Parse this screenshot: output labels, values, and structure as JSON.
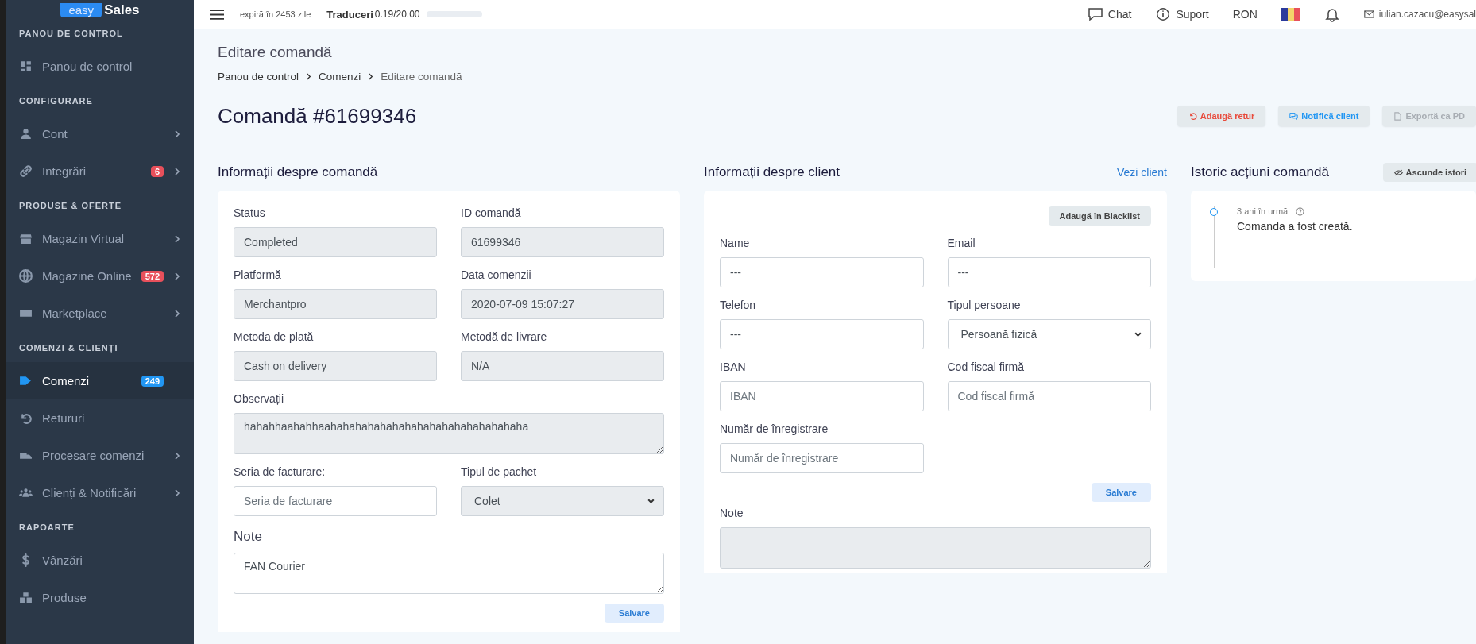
{
  "logo": {
    "part_1": "easy",
    "part_2": "Sales"
  },
  "sidebar": {
    "sections": [
      {
        "title": "PANOU DE CONTROL",
        "items": [
          {
            "label": "Panou de control",
            "expandable": false,
            "selected": false
          }
        ]
      },
      {
        "title": "CONFIGURARE",
        "items": [
          {
            "label": "Cont",
            "expandable": true,
            "selected": false
          },
          {
            "label": "Integrări",
            "expandable": true,
            "selected": false,
            "badge": "6",
            "color": "#e8505b"
          }
        ]
      },
      {
        "title": "PRODUSE & OFERTE",
        "items": [
          {
            "label": "Magazin Virtual",
            "expandable": true,
            "selected": false
          },
          {
            "label": "Magazine Online",
            "expandable": true,
            "selected": false,
            "badge": "572",
            "color": "#e8505b"
          },
          {
            "label": "Marketplace",
            "expandable": true,
            "selected": false
          }
        ]
      },
      {
        "title": "COMENZI & CLIENȚI",
        "items": [
          {
            "label": "Comenzi",
            "expandable": false,
            "selected": true,
            "badge": "249",
            "color": "#2196f3"
          },
          {
            "label": "Retururi",
            "expandable": false,
            "selected": false
          },
          {
            "label": "Procesare comenzi",
            "expandable": true,
            "selected": false
          },
          {
            "label": "Clienți & Notificări",
            "expandable": true,
            "selected": false
          }
        ]
      },
      {
        "title": "RAPOARTE",
        "items": [
          {
            "label": "Vânzări",
            "expandable": false,
            "selected": false
          },
          {
            "label": "Produse",
            "expandable": false,
            "selected": false
          }
        ]
      }
    ]
  },
  "topbar": {
    "expiry": "expiră în 2453 zile",
    "quota": {
      "label": "Traduceri",
      "value": "0.19/20.00",
      "level": 0.01
    },
    "chat": "Chat",
    "support": "Suport",
    "currency": "RON",
    "email": "iulian.cazacu@easysal"
  },
  "page_title": "Editare comandă",
  "breadcrumb": [
    "Panou de control",
    "Comenzi",
    "Editare comandă"
  ],
  "order_title": "Comandă #61699346",
  "actions": [
    {
      "label": "Adaugă retur",
      "kind": "return",
      "disabled": false
    },
    {
      "label": "Notifică client",
      "kind": "notify",
      "disabled": false
    },
    {
      "label": "Exportă ca PD",
      "kind": "export",
      "disabled": true
    }
  ],
  "order_info": {
    "title": "Informații despre comandă",
    "fields": [
      {
        "label": "Status",
        "kind": "readonly",
        "value": "Completed"
      },
      {
        "label": "ID comandă",
        "kind": "readonly",
        "value": "61699346"
      },
      {
        "label": "Platformă",
        "kind": "readonly",
        "value": "Merchantpro"
      },
      {
        "label": "Data comenzii",
        "kind": "readonly",
        "value": "2020-07-09 15:07:27"
      },
      {
        "label": "Metoda de plată",
        "kind": "readonly",
        "value": "Cash on delivery"
      },
      {
        "label": "Metodă de livrare",
        "kind": "readonly",
        "value": "N/A"
      },
      {
        "label": "Observații",
        "kind": "textarea",
        "value": "hahahhaahahhaahahahahahahahahahahahahahahahaha"
      },
      {
        "label": "Seria de facturare:",
        "kind": "input",
        "placeholder": "Seria de facturare"
      },
      {
        "label": "Tipul de pachet",
        "kind": "select_readonly",
        "value": "Colet"
      }
    ],
    "note": {
      "title": "Note",
      "value": "FAN Courier"
    },
    "save": "Salvare"
  },
  "client_info": {
    "title": "Informații despre client",
    "link": "Vezi client",
    "blacklist": "Adaugă în Blacklist",
    "fields": [
      {
        "label": "Name",
        "kind": "input",
        "value": "---"
      },
      {
        "label": "Email",
        "kind": "input",
        "value": "---"
      },
      {
        "label": "Telefon",
        "kind": "input",
        "value": "---"
      },
      {
        "label": "Tipul persoane",
        "kind": "select",
        "value": "Persoană fizică"
      },
      {
        "label": "IBAN",
        "kind": "input",
        "placeholder": "IBAN"
      },
      {
        "label": "Cod fiscal firmă",
        "kind": "input",
        "placeholder": "Cod fiscal firmă"
      },
      {
        "label": "Număr de înregistrare",
        "kind": "input",
        "placeholder": "Număr de înregistrare"
      }
    ],
    "save": "Salvare",
    "note_label": "Note"
  },
  "history": {
    "title": "Istoric acțiuni comandă",
    "hide": "Ascunde istori",
    "entries": [
      {
        "time": "3 ani în urmă",
        "text": "Comanda a fost creată."
      }
    ]
  }
}
